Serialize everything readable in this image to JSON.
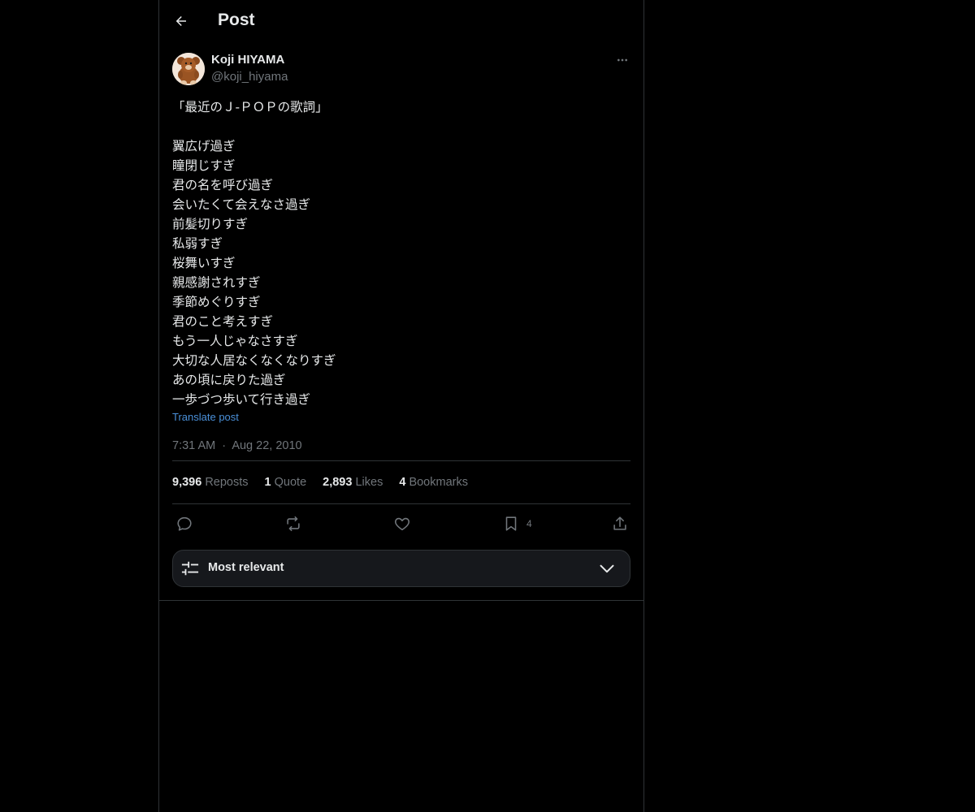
{
  "header": {
    "title": "Post",
    "back_icon": "arrow-left-icon"
  },
  "post": {
    "author": {
      "display_name": "Koji HIYAMA",
      "handle": "@koji_hiyama",
      "avatar_icon": "teddy-bear-avatar"
    },
    "more_icon": "ellipsis-icon",
    "lines": [
      "「最近のＪ-ＰＯＰの歌詞」",
      "",
      "翼広げ過ぎ",
      "瞳閉じすぎ",
      "君の名を呼び過ぎ",
      "会いたくて会えなさ過ぎ",
      "前髪切りすぎ",
      "私弱すぎ",
      "桜舞いすぎ",
      "親感謝されすぎ",
      "季節めぐりすぎ",
      "君のこと考えすぎ",
      "もう一人じゃなさすぎ",
      "大切な人居なくなくなりすぎ",
      "あの頃に戻りた過ぎ",
      "一歩づつ歩いて行き過ぎ"
    ],
    "translate_label": "Translate post",
    "time": "7:31 AM",
    "separator": "·",
    "date": "Aug 22, 2010",
    "stats": {
      "reposts_count": "9,396",
      "reposts_label": "Reposts",
      "quotes_count": "1",
      "quotes_label": "Quote",
      "likes_count": "2,893",
      "likes_label": "Likes",
      "bookmarks_count": "4",
      "bookmarks_label": "Bookmarks"
    },
    "actions": {
      "reply_icon": "reply-icon",
      "repost_icon": "repost-icon",
      "like_icon": "heart-icon",
      "bookmark_icon": "bookmark-icon",
      "bookmark_count": "4",
      "share_icon": "share-icon"
    }
  },
  "sort": {
    "label": "Most relevant",
    "icon": "sliders-icon",
    "chevron": "chevron-down-icon"
  },
  "colors": {
    "background": "#000000",
    "text": "#e7e9ea",
    "muted": "#71767b",
    "link": "#4a90d9",
    "border": "#2f3336"
  }
}
